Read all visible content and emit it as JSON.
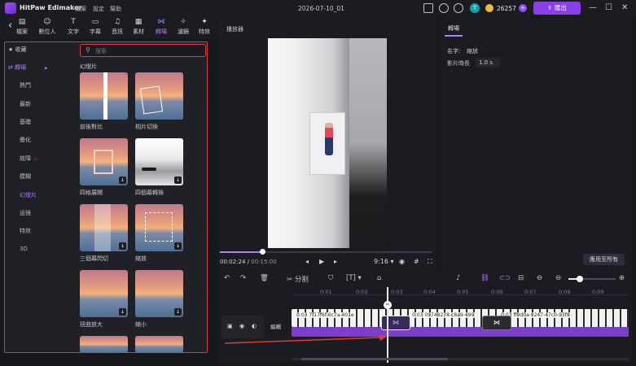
{
  "app": {
    "name": "HitPaw Edimakor",
    "project_title": "2026-07-10_01",
    "credits": "26257",
    "export_label": "匯出",
    "avatar_letter": "T"
  },
  "menu": [
    "檔案",
    "設定",
    "幫助"
  ],
  "toolbar": {
    "items": [
      {
        "label": "檔案",
        "icon": "file-icon"
      },
      {
        "label": "數位人",
        "icon": "avatar-icon"
      },
      {
        "label": "文字",
        "icon": "text-icon"
      },
      {
        "label": "字幕",
        "icon": "subtitle-icon"
      },
      {
        "label": "音訊",
        "icon": "audio-icon"
      },
      {
        "label": "素材",
        "icon": "media-icon"
      },
      {
        "label": "轉場",
        "icon": "transition-icon"
      },
      {
        "label": "濾鏡",
        "icon": "filter-icon"
      },
      {
        "label": "特效",
        "icon": "effect-icon"
      }
    ],
    "active": "轉場"
  },
  "sidebar": {
    "favorites": "收藏",
    "category": "轉場",
    "items": [
      "熱門",
      "最新",
      "基礎",
      "疊化",
      "故障",
      "模糊",
      "幻燈片",
      "运镜",
      "特效",
      "3D"
    ],
    "selected": "幻燈片"
  },
  "search": {
    "placeholder": "搜索"
  },
  "grid": {
    "section_title": "幻燈片",
    "thumbs": [
      {
        "label": "前後對比",
        "style": "sunset"
      },
      {
        "label": "相片切換",
        "style": "sunset"
      },
      {
        "label": "四格展開",
        "style": "sunset"
      },
      {
        "label": "四個幕轉換",
        "style": "gray"
      },
      {
        "label": "三個幕閃切",
        "style": "sunset"
      },
      {
        "label": "縮放",
        "style": "sunset"
      },
      {
        "label": "扭曲放大",
        "style": "sunset"
      },
      {
        "label": "縮小",
        "style": "sunset"
      }
    ]
  },
  "player": {
    "title": "播放器",
    "current_time": "00:02:24",
    "total_time": "00:15:00",
    "aspect": "9:16",
    "progress": 0.2
  },
  "properties": {
    "tab": "轉場",
    "name_label": "名字:",
    "name_value": "縮放",
    "duration_label": "影片時長",
    "duration_value": "1.0 s",
    "apply_label": "應用至所有"
  },
  "timeline": {
    "split_label": "分割",
    "track_label": "編輯",
    "ruler": [
      "0:01",
      "0:02",
      "0:03",
      "0:04",
      "0:05",
      "0:06",
      "0:07",
      "0:08",
      "0:09"
    ],
    "clips": [
      "0:03 7f17f6f-6c7a-401e",
      "0:03 09748278-c8a9-499",
      "0:03 ff9d0a-9247-47c0-93f8"
    ]
  },
  "colors": {
    "accent": "#b07cff",
    "highlight": "#e0393a",
    "export": "#8b3fe8"
  }
}
